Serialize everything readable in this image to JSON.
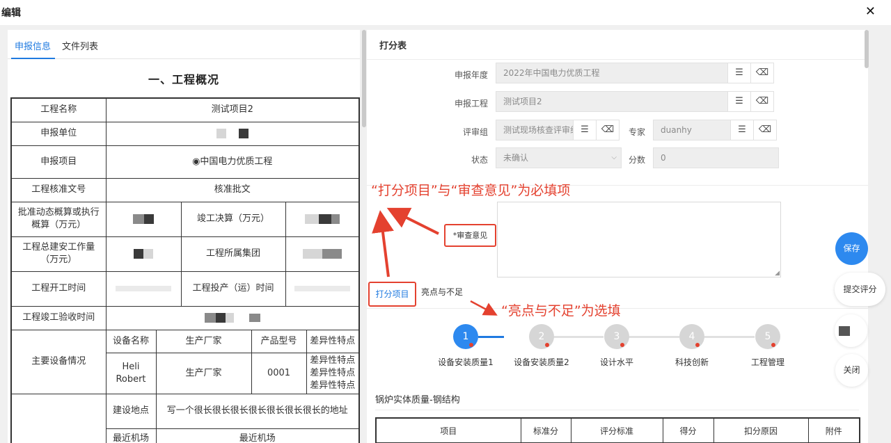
{
  "window": {
    "title": "编辑",
    "close_glyph": "✕"
  },
  "left_panel": {
    "tabs": [
      {
        "label": "申报信息"
      },
      {
        "label": "文件列表"
      }
    ],
    "section_title": "一、工程概况",
    "rows": {
      "project_name_label": "工程名称",
      "project_name_value": "测试项目2",
      "unit_label": "申报单位",
      "item_label": "申报项目",
      "item_value": "◉中国电力优质工程",
      "approval_label": "工程核准文号",
      "approval_value": "核准批文",
      "budget_label": "批准动态概算或执行概算（万元）",
      "final_cost_label": "竣工决算（万元）",
      "workload_label": "工程总建安工作量（万元）",
      "group_label": "工程所属集团",
      "start_label": "工程开工时间",
      "operation_label": "工程投产（运）时间",
      "acceptance_label": "工程竣工验收时间",
      "equipment_label": "主要设备情况",
      "eq_headers": [
        "设备名称",
        "生产厂家",
        "产品型号",
        "差异性特点"
      ],
      "eq_row": [
        "Heli Robert",
        "生产厂家",
        "0001",
        "差异性特点差异性特点差异性特点"
      ],
      "location_label": "建设地点",
      "location_value": "写一个很长很长很长很长很长很长很长的地址",
      "airport_label": "最近机场",
      "airport_value": "最近机场"
    }
  },
  "right_panel": {
    "header": "打分表",
    "fields": {
      "year_label": "申报年度",
      "year_value": "2022年中国电力优质工程",
      "project_label": "申报工程",
      "project_value": "测试项目2",
      "group_label": "评审组",
      "group_value": "测试现场核查评审组",
      "expert_label": "专家",
      "expert_value": "duanhy",
      "status_label": "状态",
      "status_value": "未确认",
      "score_label": "分数",
      "score_value": "0"
    },
    "list_glyph": "☰",
    "eraser_glyph": "⌫",
    "review_label": "*审查意见",
    "score_tabs": [
      {
        "label": "打分项目"
      },
      {
        "label": "亮点与不足"
      }
    ],
    "steps": [
      {
        "num": "1",
        "label": "设备安装质量1"
      },
      {
        "num": "2",
        "label": "设备安装质量2"
      },
      {
        "num": "3",
        "label": "设计水平"
      },
      {
        "num": "4",
        "label": "科技创新"
      },
      {
        "num": "5",
        "label": "工程管理"
      }
    ],
    "sub_title": "锅炉实体质量-钢结构",
    "table_headers": [
      "项目",
      "标准分",
      "评分标准",
      "得分",
      "扣分原因",
      "附件"
    ]
  },
  "annotations": {
    "required": "“打分项目”与“审查意见”为必填项",
    "optional": "“亮点与不足”为选填"
  },
  "floating": {
    "save": "保存",
    "submit": "提交评分",
    "close": "关闭"
  },
  "colors": {
    "accent": "#1f7ae0",
    "annotation": "#e4412f"
  }
}
